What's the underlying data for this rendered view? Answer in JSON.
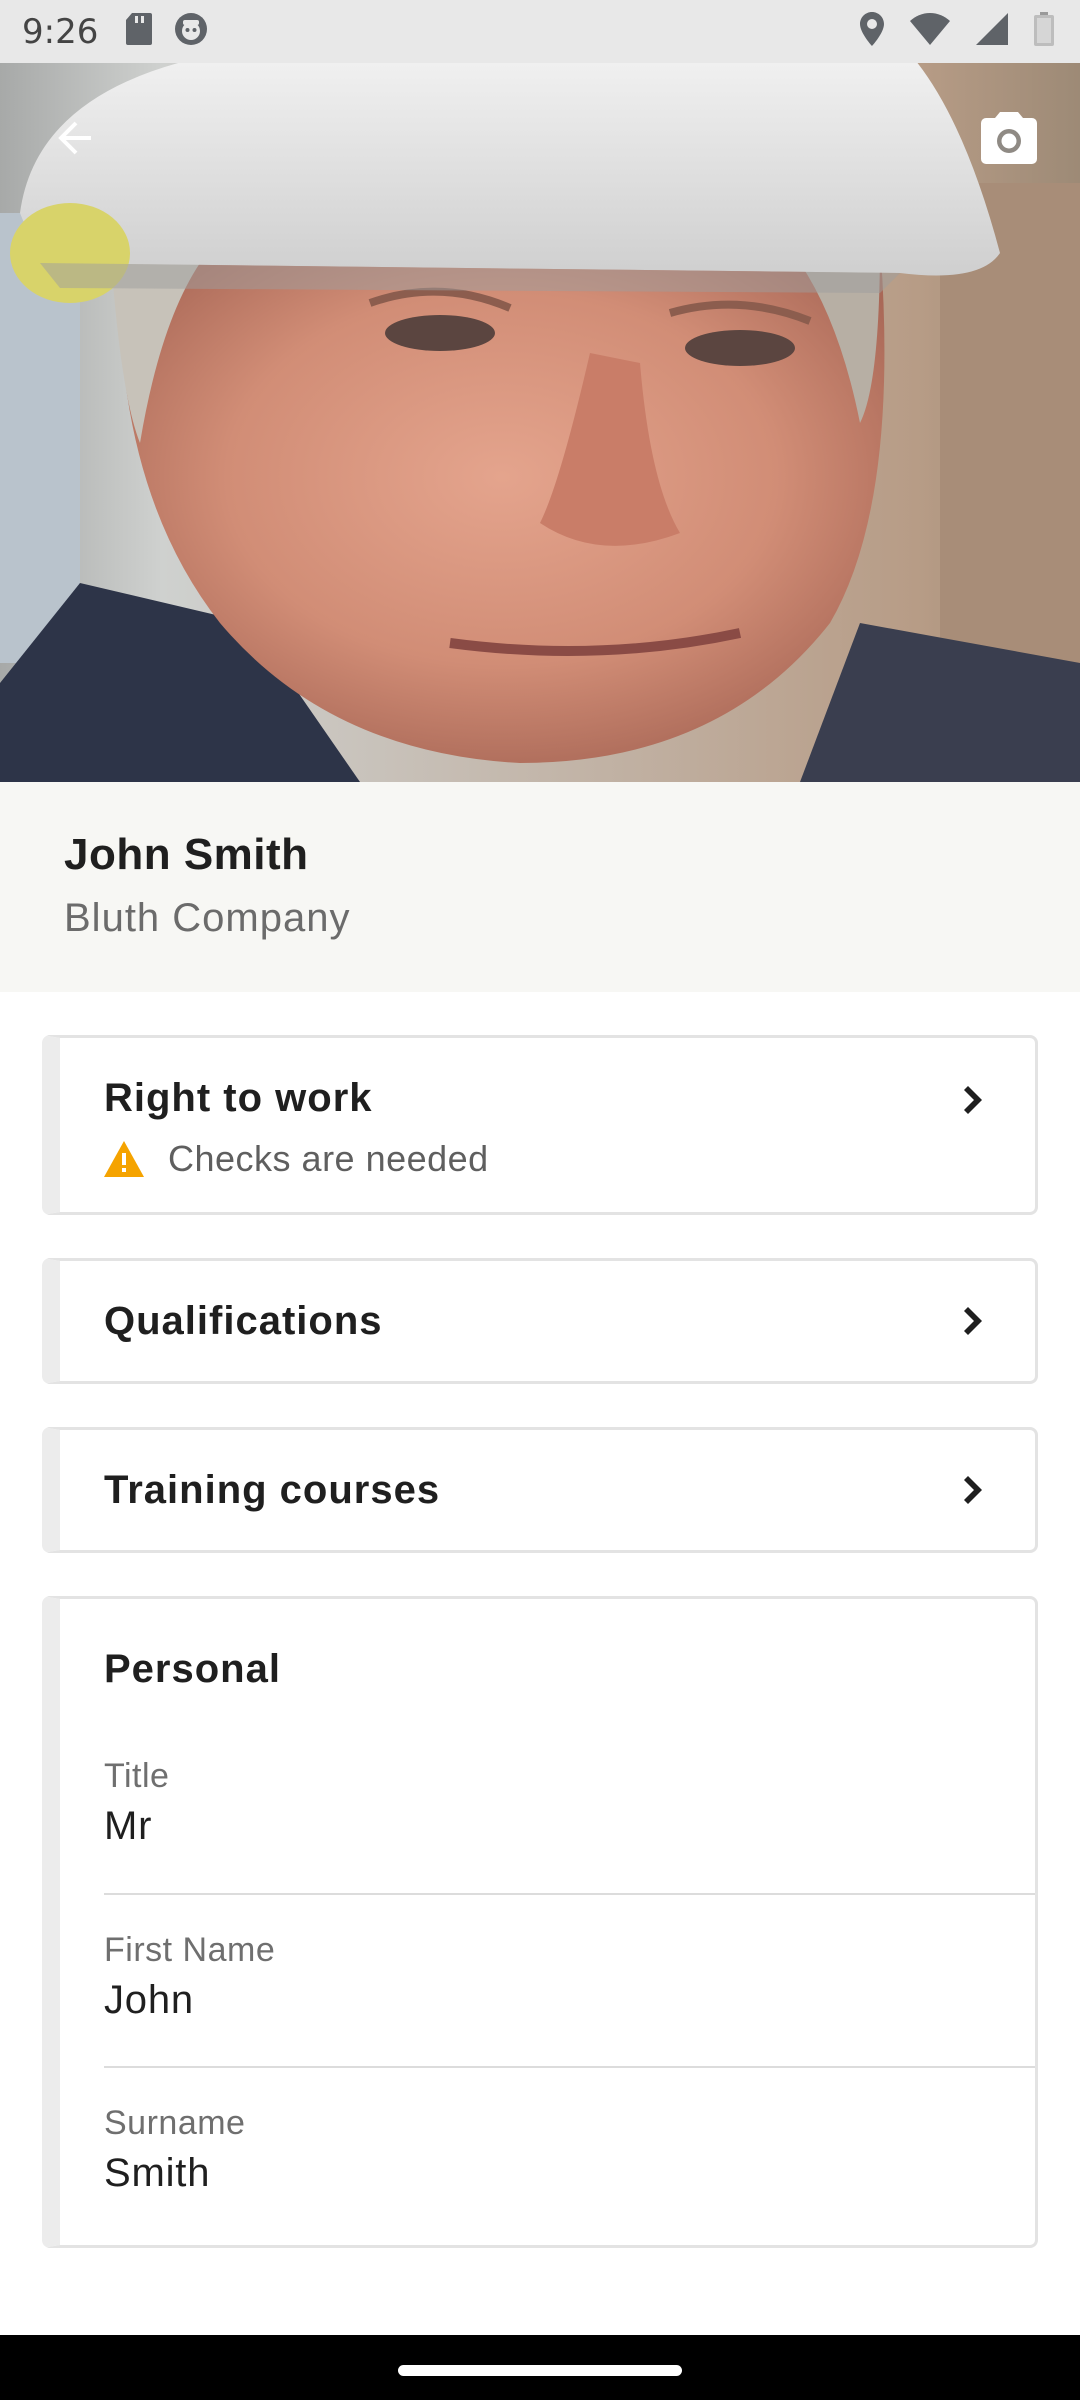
{
  "status_bar": {
    "time": "9:26"
  },
  "header": {
    "back_icon": "arrow-left-icon",
    "camera_icon": "camera-icon"
  },
  "profile": {
    "name": "John Smith",
    "company": "Bluth Company"
  },
  "cards": {
    "right_to_work": {
      "title": "Right to work",
      "status_text": "Checks are needed",
      "status_icon": "warning-icon",
      "status_color": "#f5a300"
    },
    "qualifications": {
      "title": "Qualifications"
    },
    "training_courses": {
      "title": "Training courses"
    }
  },
  "personal": {
    "title": "Personal",
    "fields": [
      {
        "label": "Title",
        "value": "Mr"
      },
      {
        "label": "First Name",
        "value": "John"
      },
      {
        "label": "Surname",
        "value": "Smith"
      }
    ]
  }
}
